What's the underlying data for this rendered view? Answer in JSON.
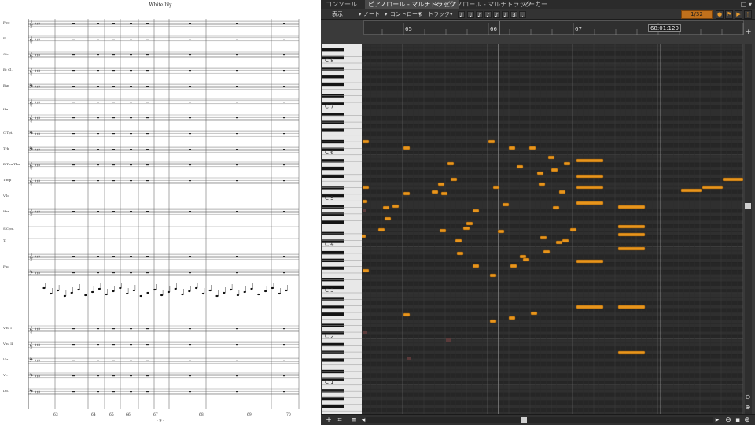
{
  "score": {
    "title": "White lily",
    "page_number": "- 9 -",
    "instruments": [
      "Picc",
      "Fl.",
      "Ob.",
      "B♭ Cl.",
      "Bsn",
      "Hn",
      "C Tpt.",
      "Trb.",
      "B.Tbn Tba",
      "Timp",
      "Vib.",
      "Har",
      "S.Cym.",
      "T.",
      "Pno",
      "Vln. I",
      "Vln. II",
      "Vla.",
      "Vc.",
      "Db."
    ],
    "measure_numbers": [
      "63",
      "64",
      "65",
      "66",
      "67",
      "68",
      "69",
      "70"
    ]
  },
  "daw": {
    "tabs": [
      {
        "label": "コンソール",
        "active": false
      },
      {
        "label": "ピアノロール - マルチトラック",
        "active": true
      },
      {
        "label": "ピアノロール - マルチトラック",
        "active": false
      },
      {
        "label": "マーカー",
        "active": false
      }
    ],
    "tab_close": "×",
    "window_buttons": "□ ▾",
    "toolbar": {
      "menus": [
        "表示",
        "ノート",
        "コントローラ",
        "トラック"
      ],
      "quantize_value": "1/32",
      "note_icons": [
        "♪",
        "♩",
        "♪",
        "♪",
        "♪",
        "♪",
        "3",
        "."
      ]
    },
    "ruler": {
      "bars": [
        "65",
        "66",
        "67"
      ],
      "position_readout": "68:01:120",
      "add_button": "+"
    },
    "keyboard": {
      "octave_labels": [
        "C 8",
        "C 7",
        "C 6",
        "C 5",
        "C 4",
        "C 3",
        "C 2",
        "C 1"
      ]
    },
    "statusbar": {
      "add": "+",
      "snap": "⌗",
      "menu": "≡",
      "left": "◂",
      "right": "▸"
    },
    "colors": {
      "note_fill": "#e8951c",
      "note_border": "#7a4a0a",
      "quantize_bg": "#c0701c",
      "grid_bg": "#2a2a2a"
    }
  }
}
